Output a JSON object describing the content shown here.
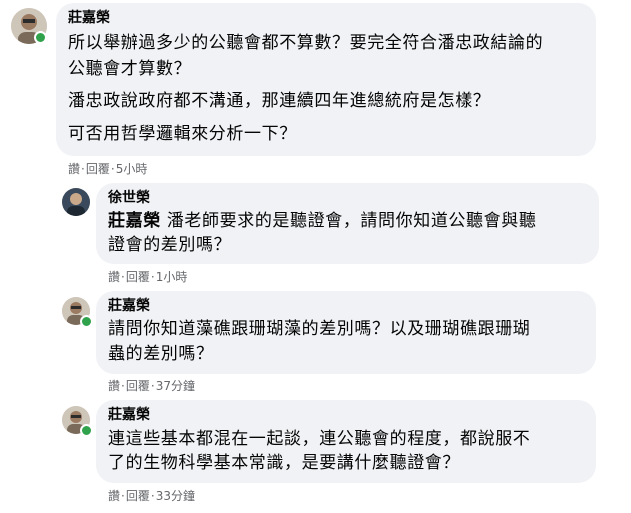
{
  "comments": [
    {
      "author": "莊嘉榮",
      "avatar_icon": "profile-photo-icon",
      "online": true,
      "paragraphs": [
        "所以舉辦過多少的公聽會都不算數？要完全符合潘忠政結論的",
        "公聽會才算數？",
        "潘忠政說政府都不溝通，那連續四年進總統府是怎樣？",
        "可否用哲學邏輯來分析一下？"
      ],
      "actions": {
        "like": "讚",
        "reply": "回覆",
        "time": "5小時"
      }
    },
    {
      "author": "徐世榮",
      "avatar_icon": "profile-photo-icon",
      "online": false,
      "mention": "莊嘉榮",
      "line1_rest": " 潘老師要求的是聽證會，請問你知道公聽會與聽",
      "line2": "證會的差別嗎？",
      "actions": {
        "like": "讚",
        "reply": "回覆",
        "time": "1小時"
      }
    },
    {
      "author": "莊嘉榮",
      "avatar_icon": "profile-photo-icon",
      "online": true,
      "line1": "請問你知道藻礁跟珊瑚藻的差別嗎？以及珊瑚礁跟珊瑚",
      "line2": "蟲的差別嗎？",
      "actions": {
        "like": "讚",
        "reply": "回覆",
        "time": "37分鐘"
      }
    },
    {
      "author": "莊嘉榮",
      "avatar_icon": "profile-photo-icon",
      "online": true,
      "line1": "連這些基本都混在一起談，連公聽會的程度，都說服不",
      "line2": "了的生物科學基本常識，是要講什麼聽證會？",
      "actions": {
        "like": "讚",
        "reply": "回覆",
        "time": "33分鐘"
      }
    }
  ],
  "colors": {
    "bubble": "#f0f2f5",
    "text": "#050505",
    "meta": "#65676b",
    "online": "#31a24c"
  }
}
